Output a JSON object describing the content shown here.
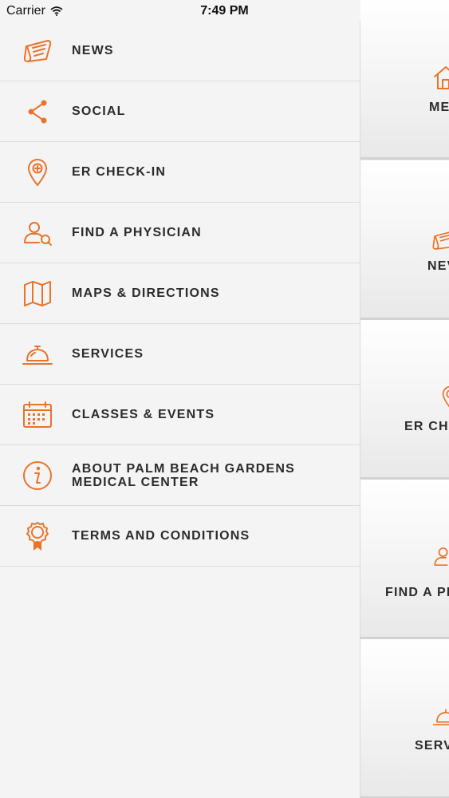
{
  "status_bar": {
    "carrier": "Carrier",
    "time": "7:49 PM"
  },
  "menu": {
    "items": [
      {
        "label": "NEWS",
        "icon": "newspaper-icon"
      },
      {
        "label": "SOCIAL",
        "icon": "share-icon"
      },
      {
        "label": "ER CHECK-IN",
        "icon": "map-pin-plus-icon"
      },
      {
        "label": "FIND A PHYSICIAN",
        "icon": "person-search-icon"
      },
      {
        "label": "MAPS & DIRECTIONS",
        "icon": "map-icon"
      },
      {
        "label": "SERVICES",
        "icon": "service-bell-icon"
      },
      {
        "label": "CLASSES & EVENTS",
        "icon": "calendar-icon"
      },
      {
        "label": "ABOUT PALM BEACH GARDENS MEDICAL CENTER",
        "icon": "info-icon"
      },
      {
        "label": "TERMS AND CONDITIONS",
        "icon": "award-ribbon-icon"
      }
    ]
  },
  "tiles": [
    {
      "label": "ME",
      "icon": "home-icon"
    },
    {
      "label": "NEV",
      "icon": "newspaper-icon"
    },
    {
      "label": "ER CHE",
      "icon": "map-pin-plus-icon"
    },
    {
      "label": "FIND A PH",
      "icon": "person-search-icon"
    },
    {
      "label": "SERV",
      "icon": "service-bell-icon"
    }
  ],
  "colors": {
    "accent": "#e8742a",
    "background": "#f4f4f5"
  }
}
